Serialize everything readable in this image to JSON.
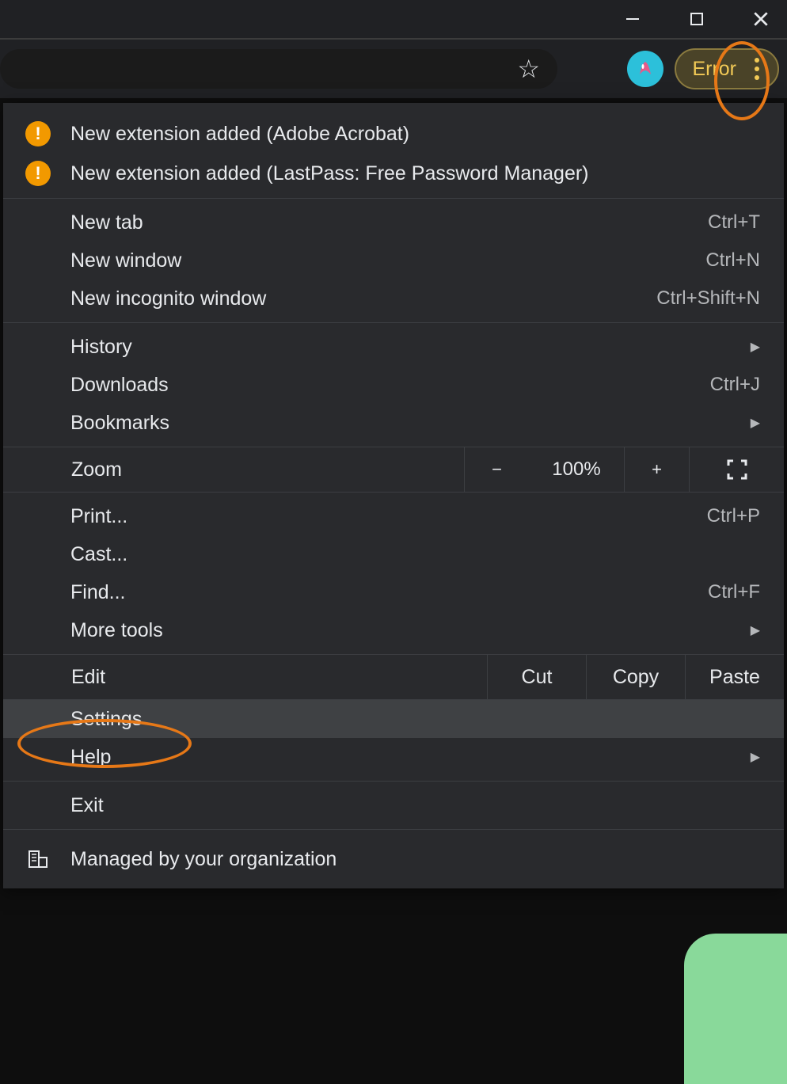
{
  "toolbar": {
    "error_label": "Error"
  },
  "notifications": [
    {
      "label": "New extension added (Adobe Acrobat)"
    },
    {
      "label": "New extension added (LastPass: Free Password Manager)"
    }
  ],
  "menu": {
    "new_tab": {
      "label": "New tab",
      "shortcut": "Ctrl+T"
    },
    "new_window": {
      "label": "New window",
      "shortcut": "Ctrl+N"
    },
    "new_incognito": {
      "label": "New incognito window",
      "shortcut": "Ctrl+Shift+N"
    },
    "history": {
      "label": "History"
    },
    "downloads": {
      "label": "Downloads",
      "shortcut": "Ctrl+J"
    },
    "bookmarks": {
      "label": "Bookmarks"
    },
    "zoom": {
      "label": "Zoom",
      "value": "100%",
      "minus": "−",
      "plus": "+"
    },
    "print": {
      "label": "Print...",
      "shortcut": "Ctrl+P"
    },
    "cast": {
      "label": "Cast..."
    },
    "find": {
      "label": "Find...",
      "shortcut": "Ctrl+F"
    },
    "more_tools": {
      "label": "More tools"
    },
    "edit": {
      "label": "Edit",
      "cut": "Cut",
      "copy": "Copy",
      "paste": "Paste"
    },
    "settings": {
      "label": "Settings"
    },
    "help": {
      "label": "Help"
    },
    "exit": {
      "label": "Exit"
    },
    "managed": {
      "label": "Managed by your organization"
    }
  }
}
